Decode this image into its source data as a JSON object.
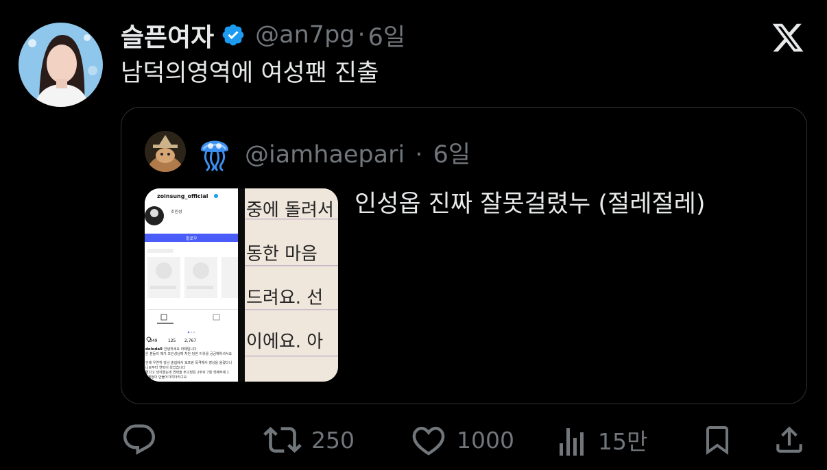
{
  "tweet": {
    "display_name": "슬픈여자",
    "handle": "@an7pg",
    "time": "6일",
    "text": "남덕의영역에 여성팬 진출"
  },
  "quoted_tweet": {
    "handle": "@iamhaepari",
    "time": "6일",
    "text": "인성옵 진짜 잘못걸렸누 (절레절레)",
    "media": {
      "left_screenshot": {
        "account": "zoinsung_official",
        "name": "조인성",
        "follow_button": "팔로우",
        "likes": "349",
        "comments": "125",
        "shares": "2,767",
        "caption_user": "doloda0",
        "caption_line1": "안녕하세요 라떼입니다",
        "caption_line2": "은 분들이 제가 조인성님께 차단 당한 이유를 궁금해하셔서요",
        "body_line1": "안에 우연히 강남 술집에서 호프링 목격해서 영상을 올렸더니",
        "body_line2": "니로부터 연락이 왔었습니다",
        "body_line3": "렸다고 생각했는데 연락을 주고받은 2주뒤 7월 셋째주에 1",
        "body_line4": "! 계정이 안들어가지더라구요"
      },
      "right_handwriting": [
        "중에 돌려서",
        "동한 마음",
        "드려요. 선",
        "이에요. 아"
      ]
    }
  },
  "actions": {
    "reply": {
      "icon": "reply-icon"
    },
    "retweet": {
      "icon": "retweet-icon",
      "count": "250"
    },
    "like": {
      "icon": "heart-icon",
      "count": "1000"
    },
    "views": {
      "icon": "views-icon",
      "count": "15만"
    },
    "bookmark": {
      "icon": "bookmark-icon"
    },
    "share": {
      "icon": "share-icon"
    }
  },
  "colors": {
    "background": "#000000",
    "text_primary": "#e7e9ea",
    "text_secondary": "#71767b",
    "verified": "#1d9bf0",
    "border": "#2f3336"
  }
}
